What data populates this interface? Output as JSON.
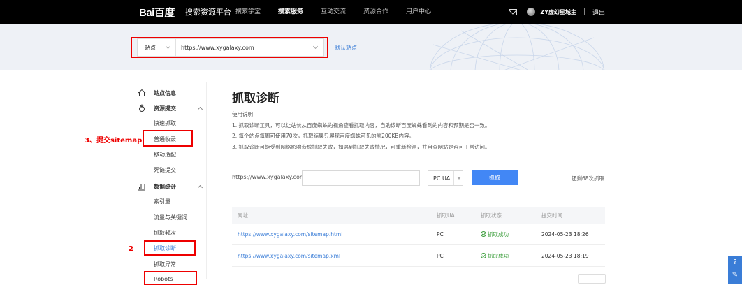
{
  "header": {
    "logo_text": "Bai百度",
    "product": "搜索资源平台",
    "nav": [
      "搜索学堂",
      "搜索服务",
      "互动交流",
      "资源合作",
      "用户中心"
    ],
    "active_nav": "搜索服务",
    "username": "ZY虚幻星城主",
    "divider": "|",
    "logout": "退出"
  },
  "site_selector": {
    "type": "站点",
    "url": "https://www.xygalaxy.com",
    "default_site": "默认站点"
  },
  "sidebar": {
    "groups": [
      {
        "label": "站点信息",
        "icon": "home-icon"
      },
      {
        "label": "资源提交",
        "icon": "submit-icon"
      },
      {
        "label": "数据统计",
        "icon": "chart-icon"
      }
    ],
    "items": [
      "快速抓取",
      "普通收录",
      "移动适配",
      "死链提交",
      "索引量",
      "流量与关键词",
      "抓取频次",
      "抓取诊断",
      "抓取异常",
      "Robots"
    ],
    "active_item": "抓取诊断"
  },
  "annotations": {
    "label_sitemap": "3、提交sitemap",
    "label_2": "2"
  },
  "main": {
    "title": "抓取诊断",
    "desc_title": "使用说明",
    "desc_lines": [
      "1. 抓取诊断工具，可以让站长从百度蜘蛛的视角查看抓取内容，自助诊断百度蜘蛛看到的内容和预期是否一致。",
      "2. 每个站点每周可使用70次，抓取结果只展现百度蜘蛛可见的前200KB内容。",
      "3. 抓取诊断可能受到网络影响造成抓取失败，如遇到抓取失败情况，可重新检测，并自查网站是否可正常访问。"
    ],
    "fetch_prefix": "https://www.xygalaxy.com/",
    "fetch_input_value": "",
    "ua_value": "PC UA",
    "fetch_button": "抓取",
    "remaining": "还剩68次抓取"
  },
  "table": {
    "headers": [
      "网址",
      "抓取UA",
      "抓取状态",
      "提交时间"
    ],
    "rows": [
      {
        "url": "https://www.xygalaxy.com/sitemap.html",
        "ua": "PC",
        "status": "抓取成功",
        "time": "2024-05-23 18:26"
      },
      {
        "url": "https://www.xygalaxy.com/sitemap.xml",
        "ua": "PC",
        "status": "抓取成功",
        "time": "2024-05-23 18:19"
      }
    ]
  },
  "colors": {
    "accent": "#4287f5",
    "link": "#3a7dd7",
    "annotation_red": "#ee0000",
    "success": "#3a9d3a",
    "topbar": "#000000"
  }
}
